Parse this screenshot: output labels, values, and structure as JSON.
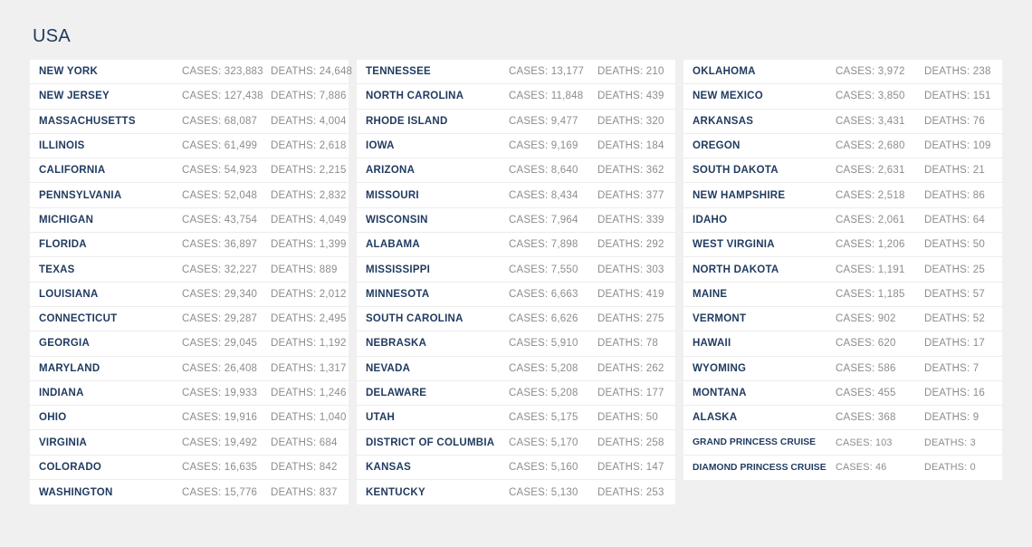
{
  "header": {
    "title": "USA"
  },
  "labels": {
    "cases_prefix": "CASES:",
    "deaths_prefix": "DEATHS:"
  },
  "colors": {
    "page_background": "#f0f0f0",
    "panel_background": "#ffffff",
    "state_name": "#1f3a5f",
    "stat_text": "#8a8d91",
    "row_divider": "#ececed",
    "title": "#1f3a5f"
  },
  "columns": [
    {
      "rows": [
        {
          "state": "NEW YORK",
          "cases": "CASES: 323,883",
          "deaths": "DEATHS: 24,648"
        },
        {
          "state": "NEW JERSEY",
          "cases": "CASES: 127,438",
          "deaths": "DEATHS: 7,886"
        },
        {
          "state": "MASSACHUSETTS",
          "cases": "CASES: 68,087",
          "deaths": "DEATHS: 4,004"
        },
        {
          "state": "ILLINOIS",
          "cases": "CASES: 61,499",
          "deaths": "DEATHS: 2,618"
        },
        {
          "state": "CALIFORNIA",
          "cases": "CASES: 54,923",
          "deaths": "DEATHS: 2,215"
        },
        {
          "state": "PENNSYLVANIA",
          "cases": "CASES: 52,048",
          "deaths": "DEATHS: 2,832"
        },
        {
          "state": "MICHIGAN",
          "cases": "CASES: 43,754",
          "deaths": "DEATHS: 4,049"
        },
        {
          "state": "FLORIDA",
          "cases": "CASES: 36,897",
          "deaths": "DEATHS: 1,399"
        },
        {
          "state": "TEXAS",
          "cases": "CASES: 32,227",
          "deaths": "DEATHS: 889"
        },
        {
          "state": "LOUISIANA",
          "cases": "CASES: 29,340",
          "deaths": "DEATHS: 2,012"
        },
        {
          "state": "CONNECTICUT",
          "cases": "CASES: 29,287",
          "deaths": "DEATHS: 2,495"
        },
        {
          "state": "GEORGIA",
          "cases": "CASES: 29,045",
          "deaths": "DEATHS: 1,192"
        },
        {
          "state": "MARYLAND",
          "cases": "CASES: 26,408",
          "deaths": "DEATHS: 1,317"
        },
        {
          "state": "INDIANA",
          "cases": "CASES: 19,933",
          "deaths": "DEATHS: 1,246"
        },
        {
          "state": "OHIO",
          "cases": "CASES: 19,916",
          "deaths": "DEATHS: 1,040"
        },
        {
          "state": "VIRGINIA",
          "cases": "CASES: 19,492",
          "deaths": "DEATHS: 684"
        },
        {
          "state": "COLORADO",
          "cases": "CASES: 16,635",
          "deaths": "DEATHS: 842"
        },
        {
          "state": "WASHINGTON",
          "cases": "CASES: 15,776",
          "deaths": "DEATHS: 837"
        }
      ]
    },
    {
      "rows": [
        {
          "state": "TENNESSEE",
          "cases": "CASES: 13,177",
          "deaths": "DEATHS: 210"
        },
        {
          "state": "NORTH CAROLINA",
          "cases": "CASES: 11,848",
          "deaths": "DEATHS: 439"
        },
        {
          "state": "RHODE ISLAND",
          "cases": "CASES: 9,477",
          "deaths": "DEATHS: 320"
        },
        {
          "state": "IOWA",
          "cases": "CASES: 9,169",
          "deaths": "DEATHS: 184"
        },
        {
          "state": "ARIZONA",
          "cases": "CASES: 8,640",
          "deaths": "DEATHS: 362"
        },
        {
          "state": "MISSOURI",
          "cases": "CASES: 8,434",
          "deaths": "DEATHS: 377"
        },
        {
          "state": "WISCONSIN",
          "cases": "CASES: 7,964",
          "deaths": "DEATHS: 339"
        },
        {
          "state": "ALABAMA",
          "cases": "CASES: 7,898",
          "deaths": "DEATHS: 292"
        },
        {
          "state": "MISSISSIPPI",
          "cases": "CASES: 7,550",
          "deaths": "DEATHS: 303"
        },
        {
          "state": "MINNESOTA",
          "cases": "CASES: 6,663",
          "deaths": "DEATHS: 419"
        },
        {
          "state": "SOUTH CAROLINA",
          "cases": "CASES: 6,626",
          "deaths": "DEATHS: 275"
        },
        {
          "state": "NEBRASKA",
          "cases": "CASES: 5,910",
          "deaths": "DEATHS: 78"
        },
        {
          "state": "NEVADA",
          "cases": "CASES: 5,208",
          "deaths": "DEATHS: 262"
        },
        {
          "state": "DELAWARE",
          "cases": "CASES: 5,208",
          "deaths": "DEATHS: 177"
        },
        {
          "state": "UTAH",
          "cases": "CASES: 5,175",
          "deaths": "DEATHS: 50"
        },
        {
          "state": "DISTRICT OF COLUMBIA",
          "cases": "CASES: 5,170",
          "deaths": "DEATHS: 258"
        },
        {
          "state": "KANSAS",
          "cases": "CASES: 5,160",
          "deaths": "DEATHS: 147"
        },
        {
          "state": "KENTUCKY",
          "cases": "CASES: 5,130",
          "deaths": "DEATHS: 253"
        }
      ]
    },
    {
      "rows": [
        {
          "state": "OKLAHOMA",
          "cases": "CASES: 3,972",
          "deaths": "DEATHS: 238"
        },
        {
          "state": "NEW MEXICO",
          "cases": "CASES: 3,850",
          "deaths": "DEATHS: 151"
        },
        {
          "state": "ARKANSAS",
          "cases": "CASES: 3,431",
          "deaths": "DEATHS: 76"
        },
        {
          "state": "OREGON",
          "cases": "CASES: 2,680",
          "deaths": "DEATHS: 109"
        },
        {
          "state": "SOUTH DAKOTA",
          "cases": "CASES: 2,631",
          "deaths": "DEATHS: 21"
        },
        {
          "state": "NEW HAMPSHIRE",
          "cases": "CASES: 2,518",
          "deaths": "DEATHS: 86"
        },
        {
          "state": "IDAHO",
          "cases": "CASES: 2,061",
          "deaths": "DEATHS: 64"
        },
        {
          "state": "WEST VIRGINIA",
          "cases": "CASES: 1,206",
          "deaths": "DEATHS: 50"
        },
        {
          "state": "NORTH DAKOTA",
          "cases": "CASES: 1,191",
          "deaths": "DEATHS: 25"
        },
        {
          "state": "MAINE",
          "cases": "CASES: 1,185",
          "deaths": "DEATHS: 57"
        },
        {
          "state": "VERMONT",
          "cases": "CASES: 902",
          "deaths": "DEATHS: 52"
        },
        {
          "state": "HAWAII",
          "cases": "CASES: 620",
          "deaths": "DEATHS: 17"
        },
        {
          "state": "WYOMING",
          "cases": "CASES: 586",
          "deaths": "DEATHS: 7"
        },
        {
          "state": "MONTANA",
          "cases": "CASES: 455",
          "deaths": "DEATHS: 16"
        },
        {
          "state": "ALASKA",
          "cases": "CASES: 368",
          "deaths": "DEATHS: 9"
        },
        {
          "state": "GRAND PRINCESS CRUISE",
          "cases": "CASES: 103",
          "deaths": "DEATHS: 3",
          "compact": true
        },
        {
          "state": "DIAMOND PRINCESS CRUISE",
          "cases": "CASES: 46",
          "deaths": "DEATHS: 0",
          "compact": true
        }
      ]
    }
  ]
}
